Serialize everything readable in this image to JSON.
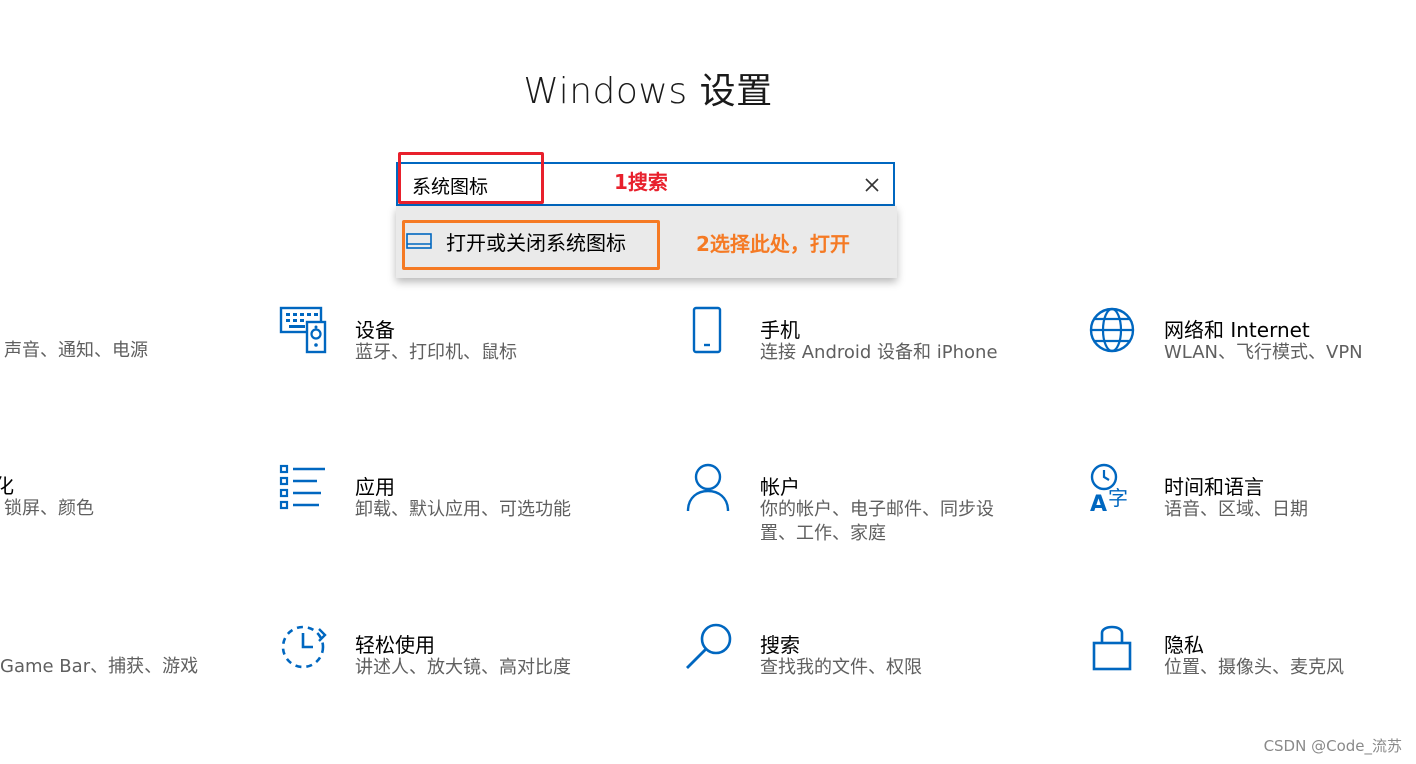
{
  "window": {
    "title": "Windows 设置"
  },
  "search": {
    "value": "系统图标",
    "suggestion": "打开或关闭系统图标"
  },
  "annotations": {
    "step1": "1搜索",
    "step2": "2选择此处，打开",
    "step1_color": "#e8202c",
    "step2_color": "#f57a24"
  },
  "accent_color": "#0067c0",
  "partial_left": {
    "row1_desc": "声音、通知、电源",
    "row2_title": "化",
    "row2_desc": "锁屏、颜色",
    "row3_desc": "Game Bar、捕获、游戏"
  },
  "tiles": [
    {
      "icon": "keyboard-speaker-icon",
      "title": "设备",
      "desc": "蓝牙、打印机、鼠标"
    },
    {
      "icon": "phone-icon",
      "title": "手机",
      "desc": "连接 Android 设备和 iPhone"
    },
    {
      "icon": "globe-icon",
      "title": "网络和 Internet",
      "desc": "WLAN、飞行模式、VPN"
    },
    {
      "icon": "apps-list-icon",
      "title": "应用",
      "desc": "卸载、默认应用、可选功能"
    },
    {
      "icon": "person-icon",
      "title": "帐户",
      "desc": "你的帐户、电子邮件、同步设置、工作、家庭",
      "desc_line1": "你的帐户、电子邮件、同步设",
      "desc_line2": "置、工作、家庭"
    },
    {
      "icon": "time-language-icon",
      "title": "时间和语言",
      "desc": "语音、区域、日期"
    },
    {
      "icon": "ease-of-access-icon",
      "title": "轻松使用",
      "desc": "讲述人、放大镜、高对比度"
    },
    {
      "icon": "search-icon",
      "title": "搜索",
      "desc": "查找我的文件、权限"
    },
    {
      "icon": "lock-icon",
      "title": "隐私",
      "desc": "位置、摄像头、麦克风"
    }
  ],
  "watermark": "CSDN @Code_流苏"
}
